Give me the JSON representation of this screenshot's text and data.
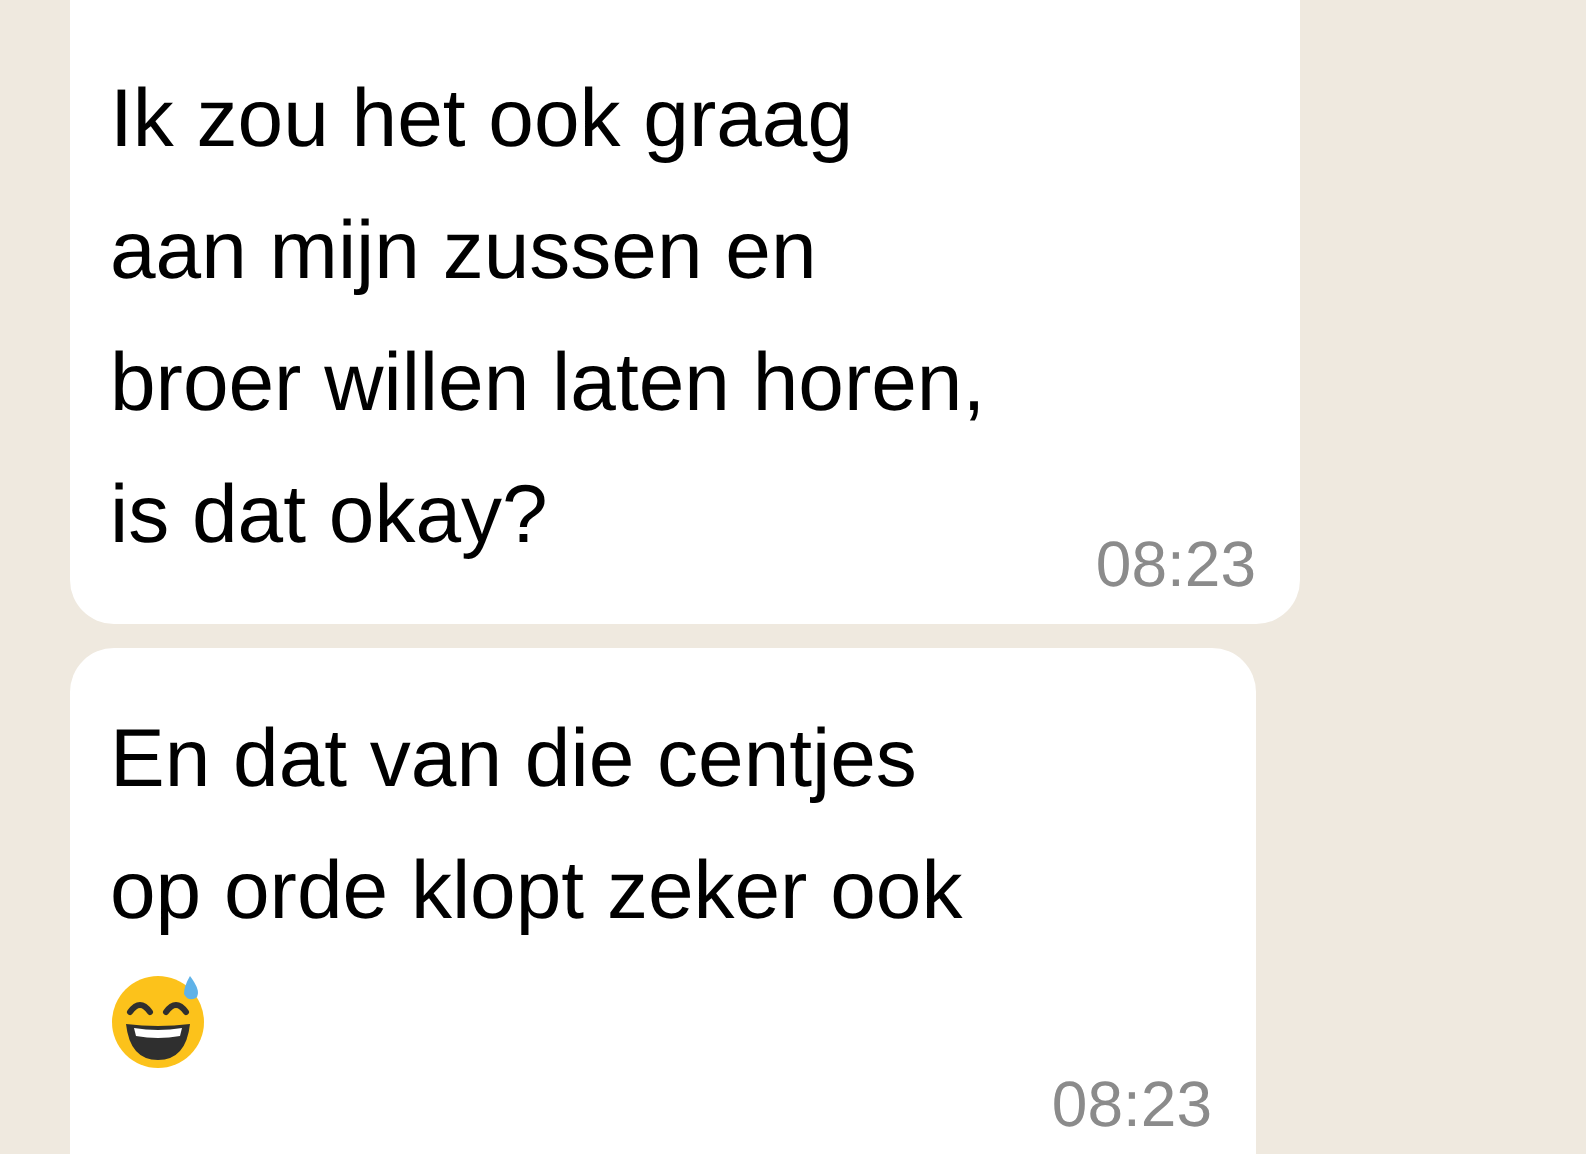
{
  "messages": [
    {
      "kind": "text",
      "lines": [
        "Ik zou het ook graag",
        "aan mijn zussen en",
        "broer willen laten horen,",
        "is dat okay?"
      ],
      "time": "08:23"
    },
    {
      "kind": "text_emoji",
      "lines": [
        "En dat van die centjes",
        "op orde klopt zeker ook"
      ],
      "time": "08:23"
    }
  ]
}
